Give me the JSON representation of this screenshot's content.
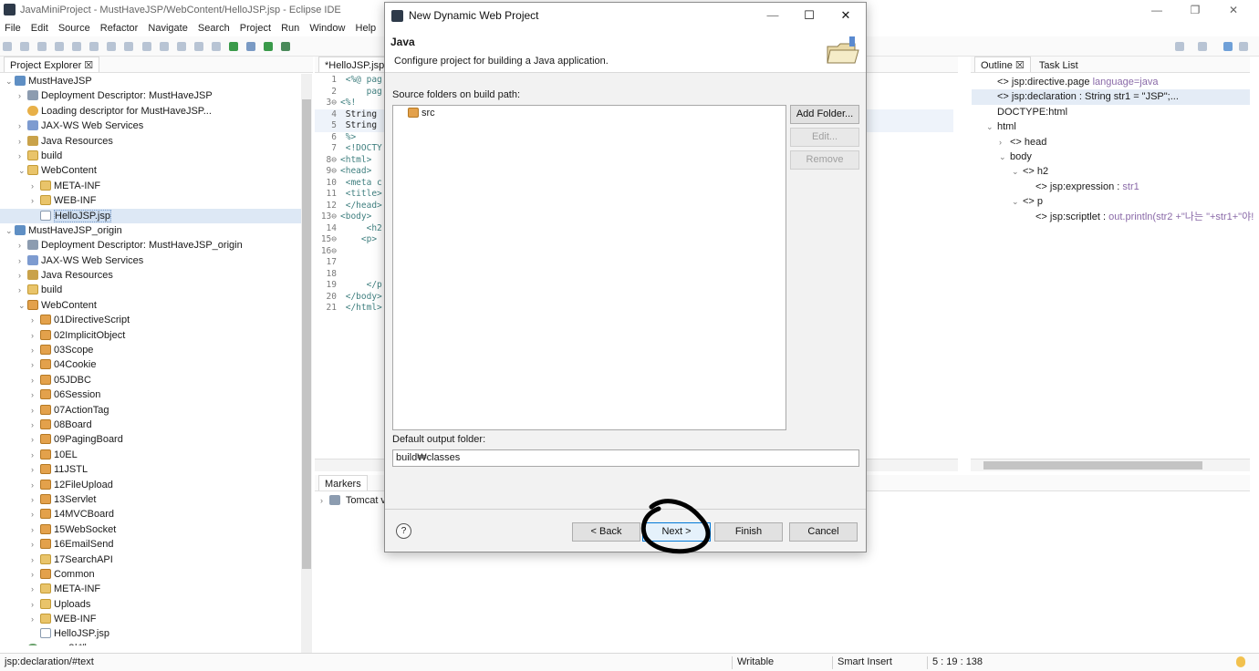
{
  "window": {
    "title": "JavaMiniProject - MustHaveJSP/WebContent/HelloJSP.jsp - Eclipse IDE",
    "minimize_glyph": "—",
    "maximize_glyph": "❐",
    "close_glyph": "✕"
  },
  "menu": [
    "File",
    "Edit",
    "Source",
    "Refactor",
    "Navigate",
    "Search",
    "Project",
    "Run",
    "Window",
    "Help"
  ],
  "project_explorer": {
    "title": "Project Explorer ☒",
    "items": [
      {
        "chev": "v",
        "icon": "ic-proj",
        "label": "MustHaveJSP",
        "indent": 0
      },
      {
        "chev": ">",
        "icon": "ic-dd",
        "label": "Deployment Descriptor: MustHaveJSP",
        "indent": 1
      },
      {
        "chev": "",
        "icon": "ic-load",
        "label": "Loading descriptor for MustHaveJSP...",
        "indent": 1
      },
      {
        "chev": ">",
        "icon": "ic-ws",
        "label": "JAX-WS Web Services",
        "indent": 1
      },
      {
        "chev": ">",
        "icon": "ic-jr",
        "label": "Java Resources",
        "indent": 1
      },
      {
        "chev": ">",
        "icon": "ic-fold",
        "label": "build",
        "indent": 1
      },
      {
        "chev": "v",
        "icon": "ic-fold",
        "label": "WebContent",
        "indent": 1
      },
      {
        "chev": ">",
        "icon": "ic-fold",
        "label": "META-INF",
        "indent": 2
      },
      {
        "chev": ">",
        "icon": "ic-fold",
        "label": "WEB-INF",
        "indent": 2
      },
      {
        "chev": "",
        "icon": "ic-file",
        "label": "HelloJSP.jsp",
        "indent": 2,
        "selected": true
      },
      {
        "chev": "v",
        "icon": "ic-proj",
        "label": "MustHaveJSP_origin",
        "indent": 0
      },
      {
        "chev": ">",
        "icon": "ic-dd",
        "label": "Deployment Descriptor: MustHaveJSP_origin",
        "indent": 1
      },
      {
        "chev": ">",
        "icon": "ic-ws",
        "label": "JAX-WS Web Services",
        "indent": 1
      },
      {
        "chev": ">",
        "icon": "ic-jr",
        "label": "Java Resources",
        "indent": 1
      },
      {
        "chev": ">",
        "icon": "ic-fold",
        "label": "build",
        "indent": 1
      },
      {
        "chev": "v",
        "icon": "ic-pkg",
        "label": "WebContent",
        "indent": 1
      },
      {
        "chev": ">",
        "icon": "ic-pkg",
        "label": "01DirectiveScript",
        "indent": 2
      },
      {
        "chev": ">",
        "icon": "ic-pkg",
        "label": "02ImplicitObject",
        "indent": 2
      },
      {
        "chev": ">",
        "icon": "ic-pkg",
        "label": "03Scope",
        "indent": 2
      },
      {
        "chev": ">",
        "icon": "ic-pkg",
        "label": "04Cookie",
        "indent": 2
      },
      {
        "chev": ">",
        "icon": "ic-pkg",
        "label": "05JDBC",
        "indent": 2
      },
      {
        "chev": ">",
        "icon": "ic-pkg",
        "label": "06Session",
        "indent": 2
      },
      {
        "chev": ">",
        "icon": "ic-pkg",
        "label": "07ActionTag",
        "indent": 2
      },
      {
        "chev": ">",
        "icon": "ic-pkg",
        "label": "08Board",
        "indent": 2
      },
      {
        "chev": ">",
        "icon": "ic-pkg",
        "label": "09PagingBoard",
        "indent": 2
      },
      {
        "chev": ">",
        "icon": "ic-pkg",
        "label": "10EL",
        "indent": 2
      },
      {
        "chev": ">",
        "icon": "ic-pkg",
        "label": "11JSTL",
        "indent": 2
      },
      {
        "chev": ">",
        "icon": "ic-pkg",
        "label": "12FileUpload",
        "indent": 2
      },
      {
        "chev": ">",
        "icon": "ic-pkg",
        "label": "13Servlet",
        "indent": 2
      },
      {
        "chev": ">",
        "icon": "ic-pkg",
        "label": "14MVCBoard",
        "indent": 2
      },
      {
        "chev": ">",
        "icon": "ic-pkg",
        "label": "15WebSocket",
        "indent": 2
      },
      {
        "chev": ">",
        "icon": "ic-pkg",
        "label": "16EmailSend",
        "indent": 2
      },
      {
        "chev": ">",
        "icon": "ic-fold",
        "label": "17SearchAPI",
        "indent": 2
      },
      {
        "chev": ">",
        "icon": "ic-pkg",
        "label": "Common",
        "indent": 2
      },
      {
        "chev": ">",
        "icon": "ic-fold",
        "label": "META-INF",
        "indent": 2
      },
      {
        "chev": ">",
        "icon": "ic-fold",
        "label": "Uploads",
        "indent": 2
      },
      {
        "chev": ">",
        "icon": "ic-fold",
        "label": "WEB-INF",
        "indent": 2
      },
      {
        "chev": "",
        "icon": "ic-file",
        "label": "HelloJSP.jsp",
        "indent": 2
      },
      {
        "chev": "",
        "icon": "ic-img",
        "label": "cover 입체.png",
        "indent": 1
      }
    ]
  },
  "editor": {
    "tab": "*HelloJSP.jsp",
    "lines": [
      {
        "n": "1",
        "t": " <%@ pag"
      },
      {
        "n": "2",
        "t": "     pag"
      },
      {
        "n": "3⊖",
        "t": "<%!"
      },
      {
        "n": "4",
        "t": " String"
      },
      {
        "n": "5",
        "t": " String"
      },
      {
        "n": "6",
        "t": " %>"
      },
      {
        "n": "7",
        "t": " <!DOCTY"
      },
      {
        "n": "8⊖",
        "t": "<html>"
      },
      {
        "n": "9⊖",
        "t": "<head>"
      },
      {
        "n": "10",
        "t": " <meta c"
      },
      {
        "n": "11",
        "t": " <title>"
      },
      {
        "n": "12",
        "t": " </head>"
      },
      {
        "n": "13⊖",
        "t": "<body>"
      },
      {
        "n": "14",
        "t": "     <h2"
      },
      {
        "n": "15⊖",
        "t": "    <p>"
      },
      {
        "n": "16⊖",
        "t": ""
      },
      {
        "n": "17",
        "t": ""
      },
      {
        "n": "18",
        "t": ""
      },
      {
        "n": "19",
        "t": "     </p"
      },
      {
        "n": "20",
        "t": " </body>"
      },
      {
        "n": "21",
        "t": " </html>"
      }
    ]
  },
  "outline": {
    "tab1": "Outline ☒",
    "tab2": "Task List",
    "items": [
      {
        "indent": 0,
        "chev": "",
        "label": "<> jsp:directive.page",
        "extra": " language=java"
      },
      {
        "indent": 0,
        "chev": "",
        "label": "<> jsp:declaration : String str1 = \"JSP\";...",
        "extra": "",
        "selected": true
      },
      {
        "indent": 0,
        "chev": "",
        "label": "DOCTYPE:html",
        "extra": ""
      },
      {
        "indent": 0,
        "chev": "v",
        "label": "html",
        "extra": ""
      },
      {
        "indent": 1,
        "chev": ">",
        "label": "<> head",
        "extra": ""
      },
      {
        "indent": 1,
        "chev": "v",
        "label": "body",
        "extra": ""
      },
      {
        "indent": 2,
        "chev": "v",
        "label": "<> h2",
        "extra": ""
      },
      {
        "indent": 3,
        "chev": "",
        "label": "<> jsp:expression :",
        "extra": " str1"
      },
      {
        "indent": 2,
        "chev": "v",
        "label": "<> p",
        "extra": ""
      },
      {
        "indent": 3,
        "chev": "",
        "label": "<> jsp:scriptlet :",
        "extra": " out.println(str2 +\"나는 \"+str1+\"야!"
      }
    ]
  },
  "bottom": {
    "tab": "Markers",
    "row": "Tomcat v"
  },
  "status": {
    "left": "jsp:declaration/#text",
    "writable": "Writable",
    "insert": "Smart Insert",
    "position": "5 : 19 : 138"
  },
  "dialog": {
    "title": "New Dynamic Web Project",
    "heading": "Java",
    "description": "Configure project for building a Java application.",
    "source_label": "Source folders on build path:",
    "source_items": [
      "src"
    ],
    "add_folder": "Add Folder...",
    "edit": "Edit...",
    "remove": "Remove",
    "output_label": "Default output folder:",
    "output_value": "build₩classes",
    "help": "?",
    "back": "< Back",
    "next": "Next >",
    "finish": "Finish",
    "cancel": "Cancel"
  }
}
